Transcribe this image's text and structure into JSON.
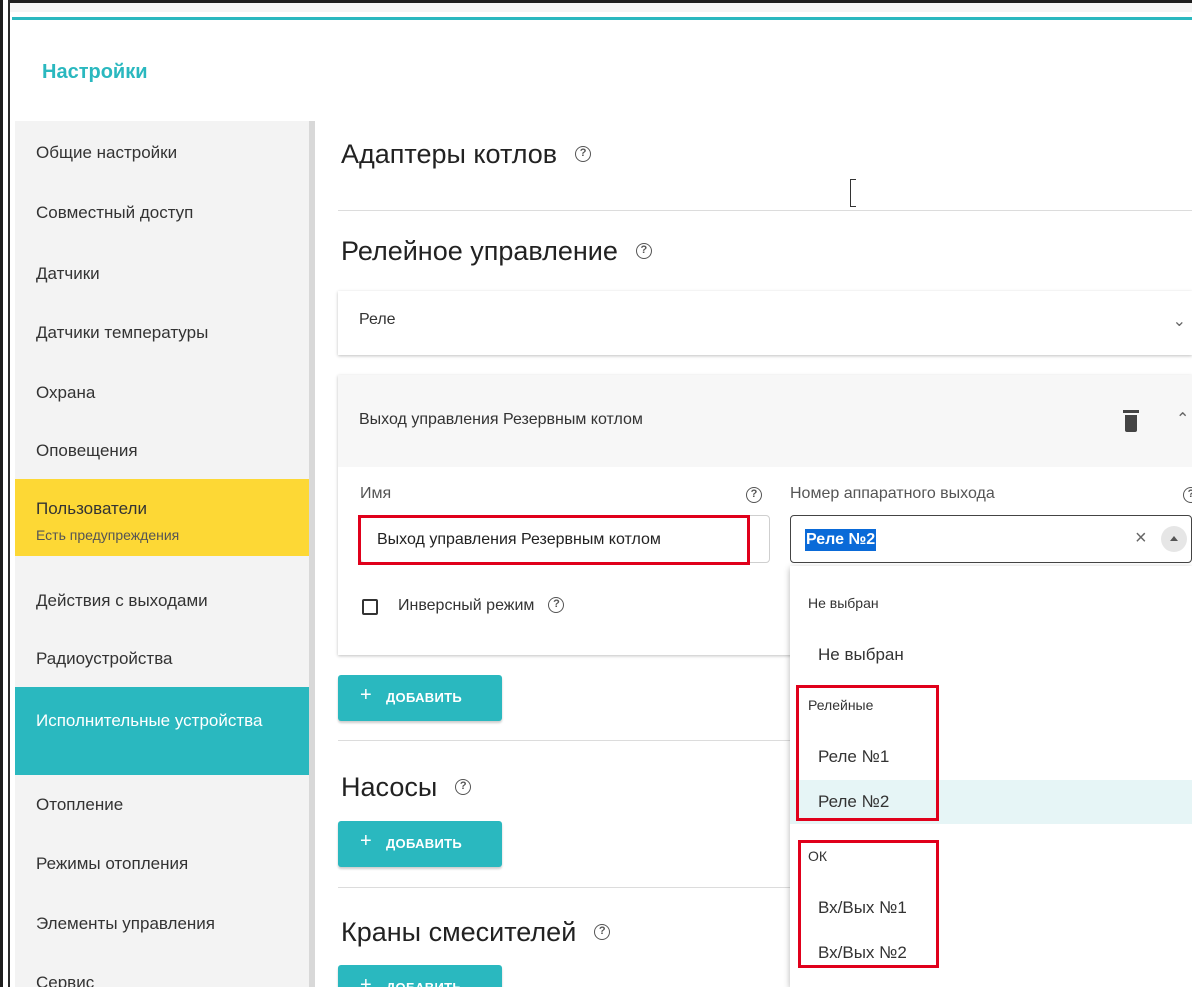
{
  "header": {
    "title": "Настройки"
  },
  "sidebar": {
    "items": [
      {
        "label": "Общие настройки"
      },
      {
        "label": "Совместный доступ"
      },
      {
        "label": "Датчики"
      },
      {
        "label": "Датчики температуры"
      },
      {
        "label": "Охрана"
      },
      {
        "label": "Оповещения"
      },
      {
        "label": "Пользователи",
        "sublabel": "Есть предупреждения"
      },
      {
        "label": "Действия с выходами"
      },
      {
        "label": "Радиоустройства"
      },
      {
        "label": "Исполнительные устройства"
      },
      {
        "label": "Отопление"
      },
      {
        "label": "Режимы отопления"
      },
      {
        "label": "Элементы управления"
      },
      {
        "label": "Сервис"
      }
    ],
    "active_index": 9,
    "warning_index": 6
  },
  "main": {
    "boiler_adapters_title": "Адаптеры котлов",
    "relay_control_title": "Релейное управление",
    "relay_card_label": "Реле",
    "output_card": {
      "title": "Выход управления Резервным котлом",
      "name_label": "Имя",
      "name_value": "Выход управления Резервным котлом",
      "hw_output_label": "Номер аппаратного выхода",
      "hw_output_value": "Реле №2",
      "inverse_label": "Инверсный режим"
    },
    "add_label": "ДОБАВИТЬ",
    "pumps_title": "Насосы",
    "mixers_title": "Краны смесителей",
    "help_glyph": "?"
  },
  "dropdown": {
    "groups": [
      {
        "title": "Не выбран",
        "options": [
          "Не выбран"
        ]
      },
      {
        "title": "Релейные",
        "options": [
          "Реле №1",
          "Реле №2"
        ]
      },
      {
        "title": "ОК",
        "options": [
          "Вх/Вых №1",
          "Вх/Вых №2"
        ]
      }
    ],
    "selected": "Реле №2"
  },
  "colors": {
    "accent": "#2ab8bf",
    "warning": "#fdd835",
    "highlight": "#e0001b",
    "selection": "#0a6ad8"
  },
  "icons": {
    "help": "help-circle-icon",
    "delete": "trash-icon",
    "expand": "chevron-down-icon",
    "collapse": "chevron-up-icon",
    "clear": "close-icon",
    "add": "plus-icon"
  }
}
